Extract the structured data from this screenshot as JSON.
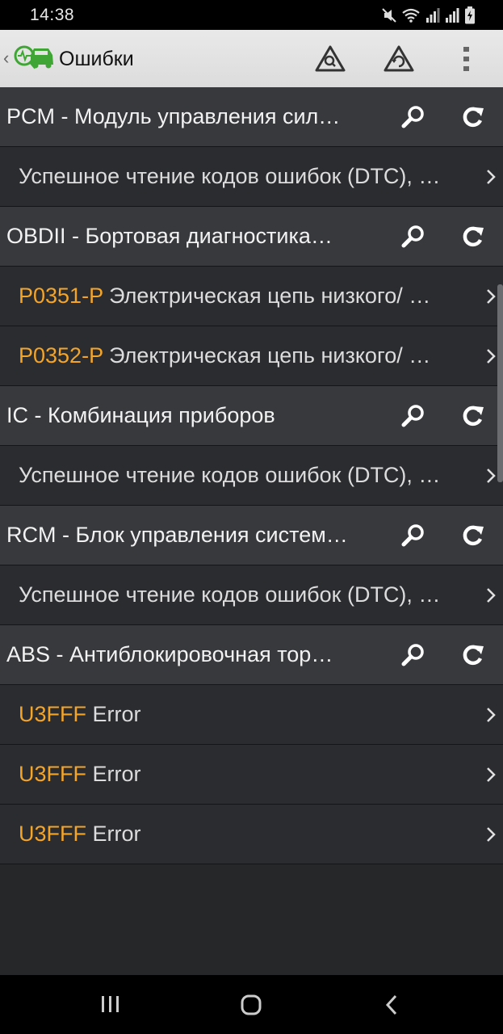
{
  "status_bar": {
    "time": "14:38",
    "icons": [
      "mute-icon",
      "wifi-icon",
      "signal-icon",
      "signal-icon",
      "battery-charging-icon"
    ]
  },
  "app_bar": {
    "title": "Ошибки",
    "actions": [
      "warning-search-icon",
      "warning-clear-icon",
      "more-vert-icon"
    ]
  },
  "list": [
    {
      "type": "header",
      "text": "PCM - Модуль управления сил…"
    },
    {
      "type": "item",
      "code": "",
      "text": "Успешное чтение кодов ошибок (DTC), …"
    },
    {
      "type": "header",
      "text": "OBDII - Бортовая диагностика…"
    },
    {
      "type": "item",
      "code": "P0351-P",
      "text": " Электрическая цепь низкого/ …"
    },
    {
      "type": "item",
      "code": "P0352-P",
      "text": " Электрическая цепь низкого/ …"
    },
    {
      "type": "header",
      "text": "IC - Комбинация приборов"
    },
    {
      "type": "item",
      "code": "",
      "text": "Успешное чтение кодов ошибок (DTC), …"
    },
    {
      "type": "header",
      "text": "RCM - Блок управления систем…"
    },
    {
      "type": "item",
      "code": "",
      "text": "Успешное чтение кодов ошибок (DTC), …"
    },
    {
      "type": "header",
      "text": "ABS - Антиблокировочная тор…"
    },
    {
      "type": "item",
      "code": "U3FFF",
      "text": " Error"
    },
    {
      "type": "item",
      "code": "U3FFF",
      "text": " Error"
    },
    {
      "type": "item",
      "code": "U3FFF",
      "text": " Error"
    }
  ],
  "colors": {
    "code": "#f3a52a",
    "header_bg": "#38393d",
    "item_bg": "#2b2c30",
    "app_bar": "#e3e3e3"
  },
  "nav_bar": [
    "recent-apps-icon",
    "home-icon",
    "back-icon"
  ]
}
